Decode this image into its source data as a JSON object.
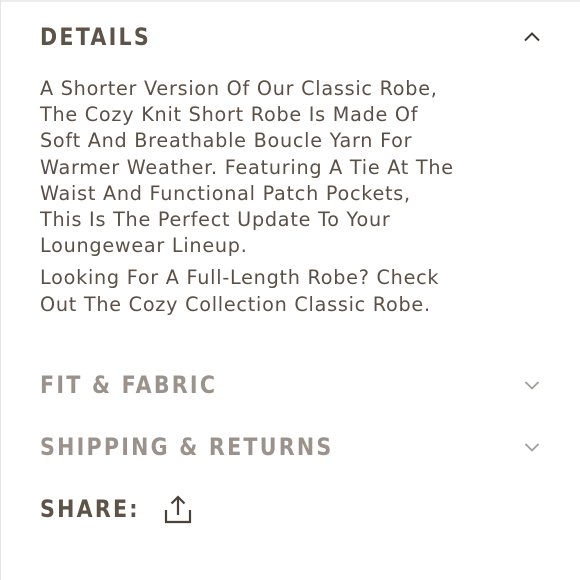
{
  "details": {
    "title": "DETAILS",
    "expanded": true,
    "toggle_icon": "chevron-up-icon",
    "paragraphs": [
      "A Shorter Version Of Our Classic Robe,\nThe Cozy Knit Short Robe Is Made Of\nSoft And Breathable Boucle Yarn For\nWarmer Weather. Featuring A Tie At The\nWaist And Functional Patch Pockets,\nThis Is The Perfect Update To Your\nLoungewear Lineup.",
      "Looking For A Full-Length Robe? Check\nOut The Cozy Collection Classic Robe."
    ]
  },
  "fit_fabric": {
    "title": "FIT & FABRIC",
    "expanded": false,
    "toggle_icon": "chevron-down-icon"
  },
  "shipping_returns": {
    "title": "SHIPPING & RETURNS",
    "expanded": false,
    "toggle_icon": "chevron-down-icon"
  },
  "share": {
    "label": "SHARE:",
    "icon": "share-icon"
  },
  "colors": {
    "text_primary": "#5b5046",
    "text_muted": "#9b938b",
    "background": "#ffffff"
  }
}
